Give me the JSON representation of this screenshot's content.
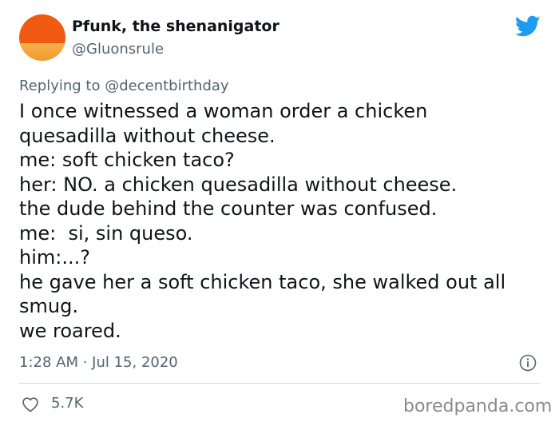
{
  "tweet": {
    "author": {
      "display_name": "Pfunk, the shenanigator",
      "handle": "@Gluonsrule",
      "avatar_icon": "sunset-avatar"
    },
    "brand_icon": "twitter-bird-icon",
    "brand_color": "#1d9bf0",
    "replying_to": {
      "prefix": "Replying to",
      "mention": "@decentbirthday"
    },
    "body_lines": [
      "I once witnessed a woman order a chicken",
      "quesadilla without cheese.",
      "me: soft chicken taco?",
      "her: NO. a chicken quesadilla without cheese.",
      "the dude behind the counter was confused.",
      "me:  si, sin queso.",
      "him:...?",
      "he gave her a soft chicken taco, she walked out all",
      "smug.",
      "we roared."
    ],
    "timestamp": "1:28 AM · Jul 15, 2020",
    "likes": "5.7K"
  },
  "watermark": "boredpanda.com"
}
